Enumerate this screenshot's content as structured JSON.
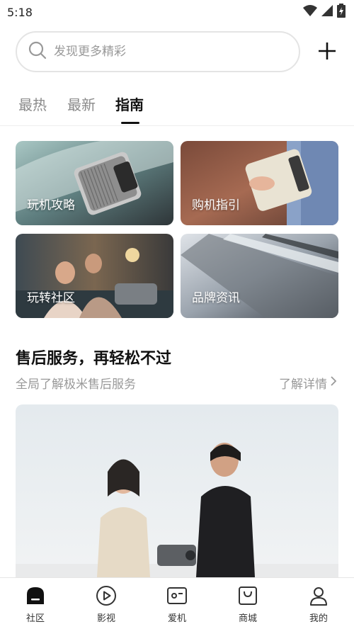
{
  "status_bar": {
    "time": "5:18",
    "icons": [
      "wifi-icon",
      "signal-icon",
      "battery-icon"
    ]
  },
  "search": {
    "placeholder": "发现更多精彩",
    "add_icon": "plus-icon"
  },
  "tabs": [
    {
      "label": "最热",
      "active": false
    },
    {
      "label": "最新",
      "active": false
    },
    {
      "label": "指南",
      "active": true
    }
  ],
  "guide_cards": [
    {
      "label": "玩机攻略"
    },
    {
      "label": "购机指引"
    },
    {
      "label": "玩转社区"
    },
    {
      "label": "品牌资讯"
    }
  ],
  "service": {
    "title": "售后服务，再轻松不过",
    "subtitle": "全局了解极米售后服务",
    "more_label": "了解详情"
  },
  "bottom_nav": [
    {
      "label": "社区",
      "icon": "home-icon",
      "active": true
    },
    {
      "label": "影视",
      "icon": "play-icon",
      "active": false
    },
    {
      "label": "爱机",
      "icon": "device-icon",
      "active": false
    },
    {
      "label": "商城",
      "icon": "shopping-bag-icon",
      "active": false
    },
    {
      "label": "我的",
      "icon": "profile-icon",
      "active": false
    }
  ],
  "colors": {
    "accent": "#111111",
    "muted_text": "#999999",
    "search_border": "#e4e4e4"
  }
}
